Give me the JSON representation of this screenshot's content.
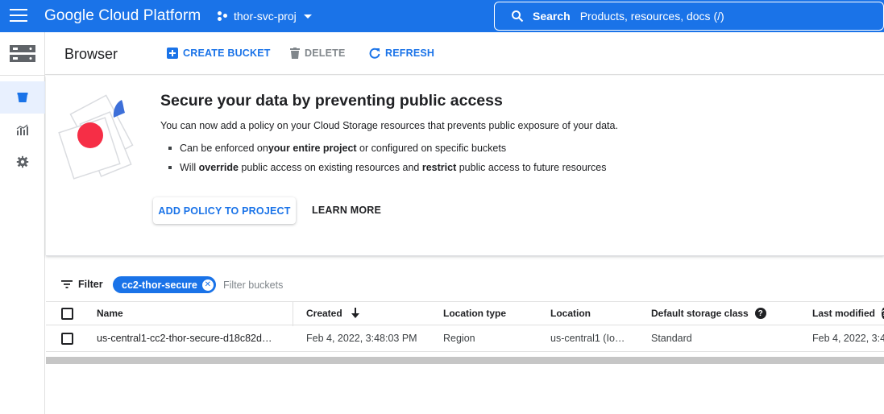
{
  "topbar": {
    "app_name": "Google Cloud Platform",
    "project_name": "thor-svc-proj",
    "search_label": "Search",
    "search_hint": "Products, resources, docs (/)"
  },
  "header": {
    "title": "Browser",
    "create_bucket": "CREATE BUCKET",
    "delete": "DELETE",
    "refresh": "REFRESH"
  },
  "banner": {
    "title": "Secure your data by preventing public access",
    "description": "You can now add a policy on your Cloud Storage resources that prevents public exposure of your data.",
    "bullet1_pre": "Can be enforced on ",
    "bullet1_bold": "your entire project",
    "bullet1_post": " or configured on specific buckets",
    "bullet2_pre": "Will ",
    "bullet2_bold1": "override",
    "bullet2_mid": " public access on existing resources and ",
    "bullet2_bold2": "restrict",
    "bullet2_post": " public access to future resources",
    "primary_button": "ADD POLICY TO PROJECT",
    "secondary_button": "LEARN MORE"
  },
  "filter": {
    "label": "Filter",
    "chip": "cc2-thor-secure",
    "placeholder": "Filter buckets"
  },
  "table": {
    "headers": {
      "name": "Name",
      "created": "Created",
      "location_type": "Location type",
      "location": "Location",
      "storage_class": "Default storage class",
      "last_modified": "Last modified"
    },
    "rows": [
      {
        "name": "us-central1-cc2-thor-secure-d18c82d…",
        "created": "Feb 4, 2022, 3:48:03 PM",
        "location_type": "Region",
        "location": "us-central1 (Io…",
        "storage_class": "Standard",
        "last_modified": "Feb 4, 2022, 3:4"
      }
    ]
  },
  "colors": {
    "brand_blue": "#1a73e8",
    "accent_red": "#f62e46",
    "illus_blue": "#3d6fd9"
  }
}
